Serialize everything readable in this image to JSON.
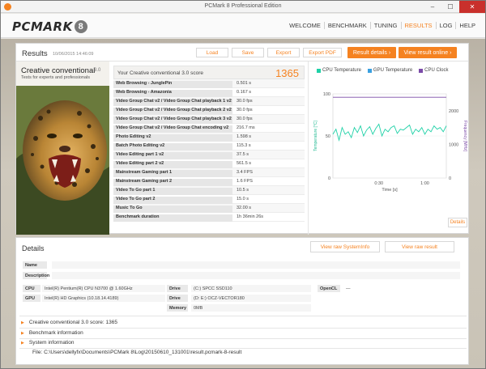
{
  "window": {
    "title": "PCMark 8 Professional Edition",
    "controls": {
      "minimize": "–",
      "maximize": "☐",
      "close": "✕"
    }
  },
  "nav": {
    "logo_text": "PCMARK",
    "logo_badge": "8",
    "items": [
      "WELCOME",
      "BENCHMARK",
      "TUNING",
      "RESULTS",
      "LOG",
      "HELP"
    ],
    "active": "RESULTS"
  },
  "results": {
    "title": "Results",
    "date": "10/06/2015 14:46:09",
    "buttons": {
      "load": "Load",
      "save": "Save",
      "export": "Export",
      "export_pdf": "Export PDF",
      "result_details": "Result details",
      "view_online": "View result online"
    },
    "benchmark": {
      "name": "Creative conventional",
      "version": "3.0",
      "subtitle": "Tests for experts and professionals"
    },
    "score_label": "Your Creative conventional 3.0 score",
    "score_value": "1365",
    "rows": [
      {
        "name": "Web Browsing - JunglePin",
        "value": "0.501 s"
      },
      {
        "name": "Web Browsing - Amazonia",
        "value": "0.167 s"
      },
      {
        "name": "Video Group Chat v2 / Video Group Chat playback 1 v2",
        "value": "30.0 fps"
      },
      {
        "name": "Video Group Chat v2 / Video Group Chat playback 2 v2",
        "value": "30.0 fps"
      },
      {
        "name": "Video Group Chat v2 / Video Group Chat playback 3 v2",
        "value": "30.0 fps"
      },
      {
        "name": "Video Group Chat v2 / Video Group Chat encoding v2",
        "value": "216.7 ms"
      },
      {
        "name": "Photo Editing v2",
        "value": "1.598 s"
      },
      {
        "name": "Batch Photo Editing v2",
        "value": "115.3 s"
      },
      {
        "name": "Video Editing part 1 v2",
        "value": "37.5 s"
      },
      {
        "name": "Video Editing part 2 v2",
        "value": "561.5 s"
      },
      {
        "name": "Mainstream Gaming part 1",
        "value": "3.4 FPS"
      },
      {
        "name": "Mainstream Gaming part 2",
        "value": "1.6 FPS"
      },
      {
        "name": "Video To Go part 1",
        "value": "10.5 s"
      },
      {
        "name": "Video To Go part 2",
        "value": "15.0 s"
      },
      {
        "name": "Music To Go",
        "value": "32.00 s"
      },
      {
        "name": "Benchmark duration",
        "value": "1h 36min 26s"
      }
    ],
    "details_button": "Details"
  },
  "chart_data": {
    "type": "line",
    "legend": [
      "CPU Temperature",
      "GPU Temperature",
      "CPU Clock"
    ],
    "legend_placement": "top",
    "xlabel": "Time [s]",
    "ylabel_left": "Temperature [°C]",
    "ylabel_right": "Frequency [MHz]",
    "x_ticks": [
      "0:30",
      "1:00"
    ],
    "y_left_ticks": [
      0,
      50,
      100
    ],
    "y_right_ticks": [
      0,
      1000,
      2000
    ],
    "y_left_range": [
      0,
      100
    ],
    "y_right_range": [
      0,
      2500
    ],
    "series": [
      {
        "name": "CPU Temperature",
        "color": "#1fd1a7",
        "axis": "left",
        "x": [
          0,
          2,
          4,
          6,
          8,
          10,
          12,
          14,
          16,
          18,
          20,
          22,
          24,
          26,
          28,
          30,
          32,
          34,
          36,
          38,
          40,
          42,
          44,
          46,
          48,
          50,
          52,
          54,
          56,
          58,
          60,
          62,
          64,
          66,
          68,
          70,
          72,
          74
        ],
        "values": [
          52,
          58,
          45,
          60,
          52,
          55,
          48,
          60,
          54,
          62,
          50,
          57,
          61,
          52,
          59,
          64,
          50,
          58,
          55,
          60,
          62,
          53,
          58,
          57,
          60,
          63,
          52,
          58,
          55,
          60,
          52,
          58,
          55,
          62,
          58,
          60,
          55,
          62
        ]
      },
      {
        "name": "CPU Clock",
        "color": "#7b4aa8",
        "axis": "right",
        "x": [
          0,
          74
        ],
        "values": [
          2400,
          2400
        ]
      }
    ],
    "colors": {
      "gpu_temperature": "#3aa0e0"
    }
  },
  "details": {
    "title": "Details",
    "buttons": {
      "systeminfo": "View raw SystemInfo",
      "raw_result": "View raw result"
    },
    "name_label": "Name",
    "desc_label": "Description",
    "cpu_label": "CPU",
    "cpu_value": "Intel(R) Pentium(R) CPU  N3700  @ 1.60GHz",
    "gpu_label": "GPU",
    "gpu_value": "Intel(R) HD Graphics (10.18.14.4189)",
    "drive_label": "Drive",
    "drive1_value": "(C:) SPCC SSD110",
    "drive2_value": "(D: E:) OCZ-VECTOR180",
    "memory_label": "Memory",
    "memory_value": "0MB",
    "opencl_label": "OpenCL",
    "opencl_value": "—",
    "expanders": [
      "Creative conventional 3.0 score: 1365",
      "Benchmark information",
      "System information"
    ],
    "file_path": "File: C:\\Users\\dellyfx\\Documents\\PCMark 8\\Log\\20150610_131001\\result.pcmark-8-result"
  }
}
